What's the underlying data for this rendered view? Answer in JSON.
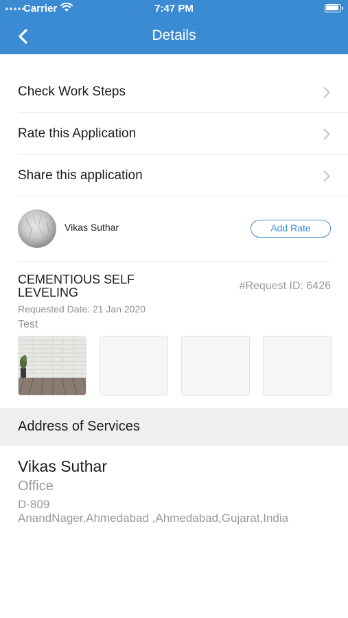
{
  "status_bar": {
    "carrier": "Carrier",
    "time": "7:47 PM"
  },
  "nav": {
    "title": "Details",
    "back_icon": "chevron-left-icon"
  },
  "menu": [
    {
      "label": "Check Work Steps",
      "icon": "chevron-right-icon"
    },
    {
      "label": "Rate this Application",
      "icon": "chevron-right-icon"
    },
    {
      "label": "Share this application",
      "icon": "chevron-right-icon"
    }
  ],
  "user": {
    "name": "Vikas Suthar",
    "add_rate_label": "Add Rate"
  },
  "request": {
    "service_title": "CEMENTIOUS SELF LEVELING",
    "request_id": "#Request ID: 6426",
    "requested_date": "Requested Date: 21 Jan 2020",
    "description": "Test"
  },
  "address": {
    "section_title": "Address of Services",
    "name": "Vikas Suthar",
    "type": "Office",
    "line1": "D-809",
    "line2": "AnandNager,Ahmedabad ,Ahmedabad,Gujarat,India"
  },
  "colors": {
    "accent": "#3b8bd3",
    "section_bg": "#efefef",
    "secondary_text": "#9a9a9a"
  }
}
